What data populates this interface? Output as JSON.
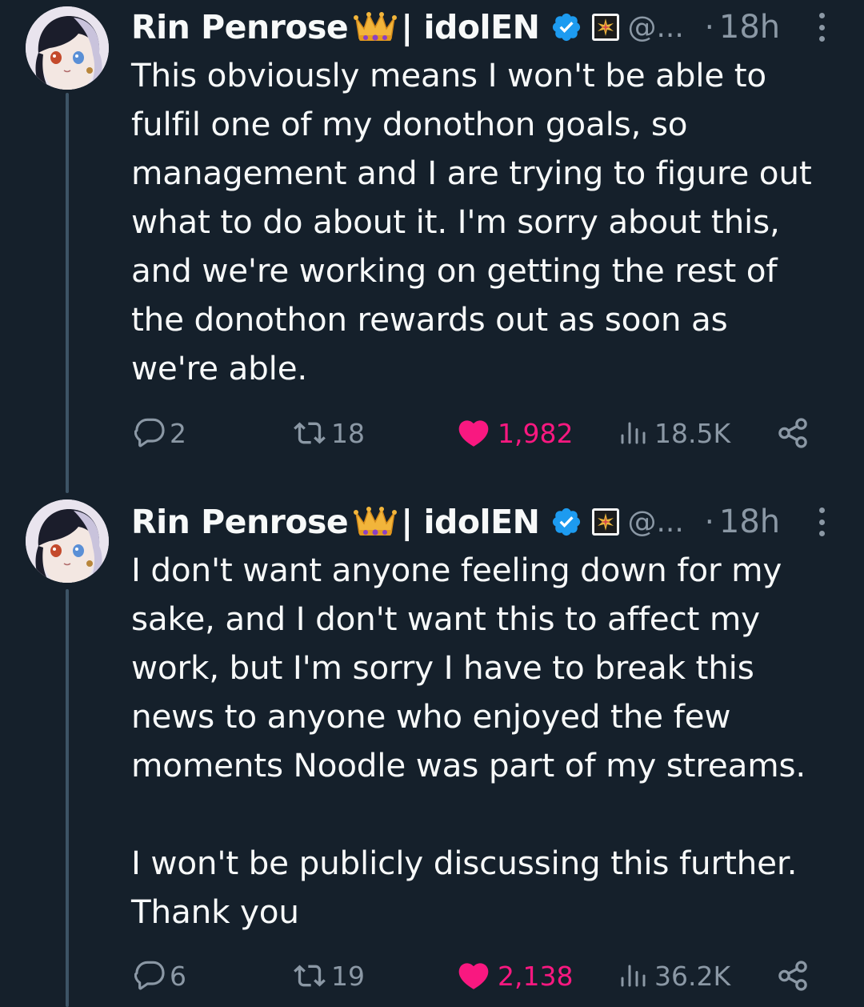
{
  "colors": {
    "background": "#15202b",
    "text_primary": "#f7f9f9",
    "text_secondary": "#8b98a5",
    "like_active": "#f91880",
    "verified": "#1d9bf0",
    "thread_line": "#3d5466"
  },
  "tweets": [
    {
      "author": {
        "display_name": "Rin Penrose",
        "name_suffix": "| idolEN",
        "handle": "@...",
        "avatar_icon": "avatar-anime-girl",
        "badges": [
          "crown-emoji-icon",
          "verified-badge-icon",
          "affiliate-flag-icon"
        ]
      },
      "separator": "·",
      "time": "18h",
      "text": "This obviously means I won't be able to\nfulfil one of my donothon goals, so\nmanagement and I are trying to figure out\nwhat to do about it. I'm sorry about this,\nand we're working on getting the rest of\nthe donothon rewards out as soon as\nwe're able.",
      "actions": {
        "replies": "2",
        "reposts": "18",
        "likes": "1,982",
        "liked": true,
        "views": "18.5K"
      }
    },
    {
      "author": {
        "display_name": "Rin Penrose",
        "name_suffix": "| idolEN",
        "handle": "@...",
        "avatar_icon": "avatar-anime-girl",
        "badges": [
          "crown-emoji-icon",
          "verified-badge-icon",
          "affiliate-flag-icon"
        ]
      },
      "separator": "·",
      "time": "18h",
      "text": "I don't want anyone feeling down for my\nsake, and I don't want this to affect my\nwork, but I'm sorry I have to break this\nnews to anyone who enjoyed the few\nmoments Noodle was part of my streams.\n\nI won't be publicly discussing this further.\nThank you",
      "actions": {
        "replies": "6",
        "reposts": "19",
        "likes": "2,138",
        "liked": true,
        "views": "36.2K"
      }
    }
  ]
}
